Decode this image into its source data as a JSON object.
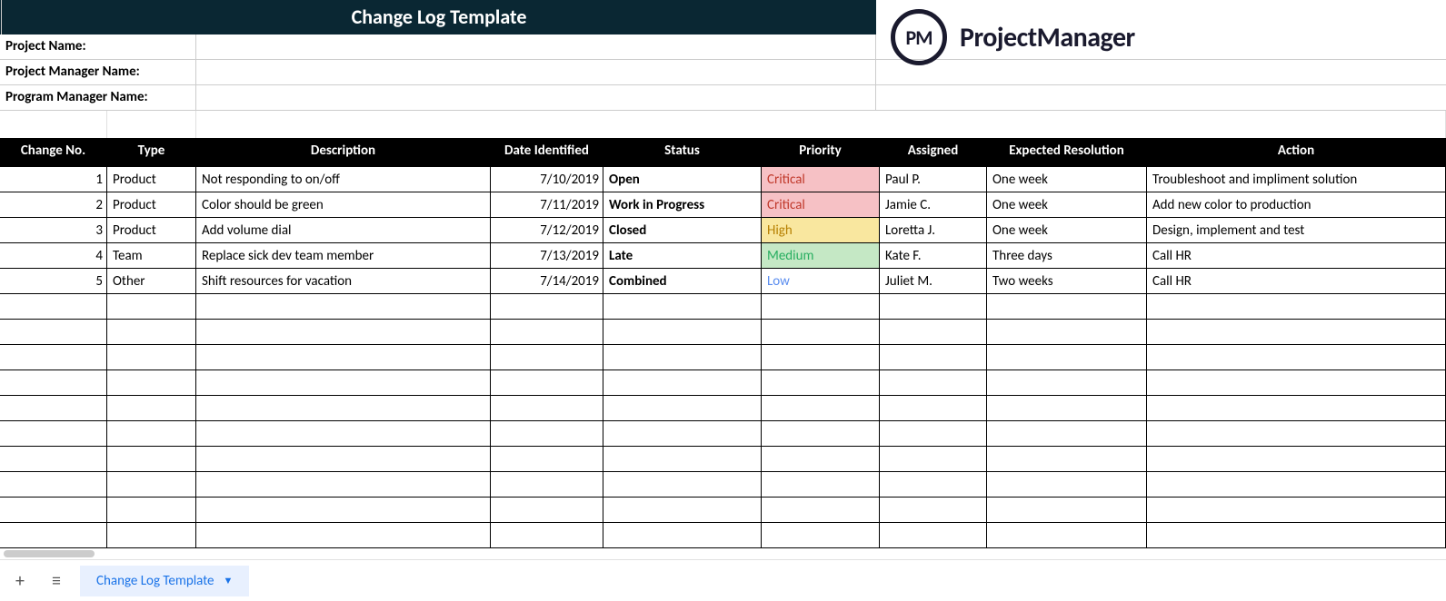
{
  "title": "Change Log Template",
  "meta": {
    "project_name_label": "Project Name:",
    "project_name_value": "",
    "project_manager_label": "Project Manager Name:",
    "project_manager_value": "",
    "program_manager_label": "Program Manager Name:",
    "program_manager_value": ""
  },
  "logo": {
    "badge": "PM",
    "text": "ProjectManager"
  },
  "headers": {
    "change_no": "Change No.",
    "type": "Type",
    "description": "Description",
    "date_identified": "Date Identified",
    "status": "Status",
    "priority": "Priority",
    "assigned": "Assigned",
    "expected_resolution": "Expected Resolution",
    "action": "Action"
  },
  "rows": [
    {
      "no": "1",
      "type": "Product",
      "desc": "Not responding to on/off",
      "date": "7/10/2019",
      "status": "Open",
      "priority": "Critical",
      "prio_class": "prio-critical",
      "assigned": "Paul P.",
      "resolution": "One week",
      "action": "Troubleshoot and impliment solution"
    },
    {
      "no": "2",
      "type": "Product",
      "desc": "Color should be green",
      "date": "7/11/2019",
      "status": "Work in Progress",
      "priority": "Critical",
      "prio_class": "prio-critical",
      "assigned": "Jamie C.",
      "resolution": "One week",
      "action": "Add new color to production"
    },
    {
      "no": "3",
      "type": "Product",
      "desc": "Add volume dial",
      "date": "7/12/2019",
      "status": "Closed",
      "priority": "High",
      "prio_class": "prio-high",
      "assigned": "Loretta J.",
      "resolution": "One week",
      "action": "Design, implement and test"
    },
    {
      "no": "4",
      "type": "Team",
      "desc": "Replace sick dev team member",
      "date": "7/13/2019",
      "status": "Late",
      "priority": "Medium",
      "prio_class": "prio-medium",
      "assigned": "Kate F.",
      "resolution": "Three days",
      "action": "Call HR"
    },
    {
      "no": "5",
      "type": "Other",
      "desc": "Shift resources for vacation",
      "date": "7/14/2019",
      "status": "Combined",
      "priority": "Low",
      "prio_class": "prio-low",
      "assigned": "Juliet M.",
      "resolution": "Two weeks",
      "action": "Call HR"
    }
  ],
  "empty_rows": 10,
  "footer": {
    "add_label": "+",
    "menu_label": "≡",
    "tab_label": "Change Log Template",
    "tab_caret": "▼"
  }
}
